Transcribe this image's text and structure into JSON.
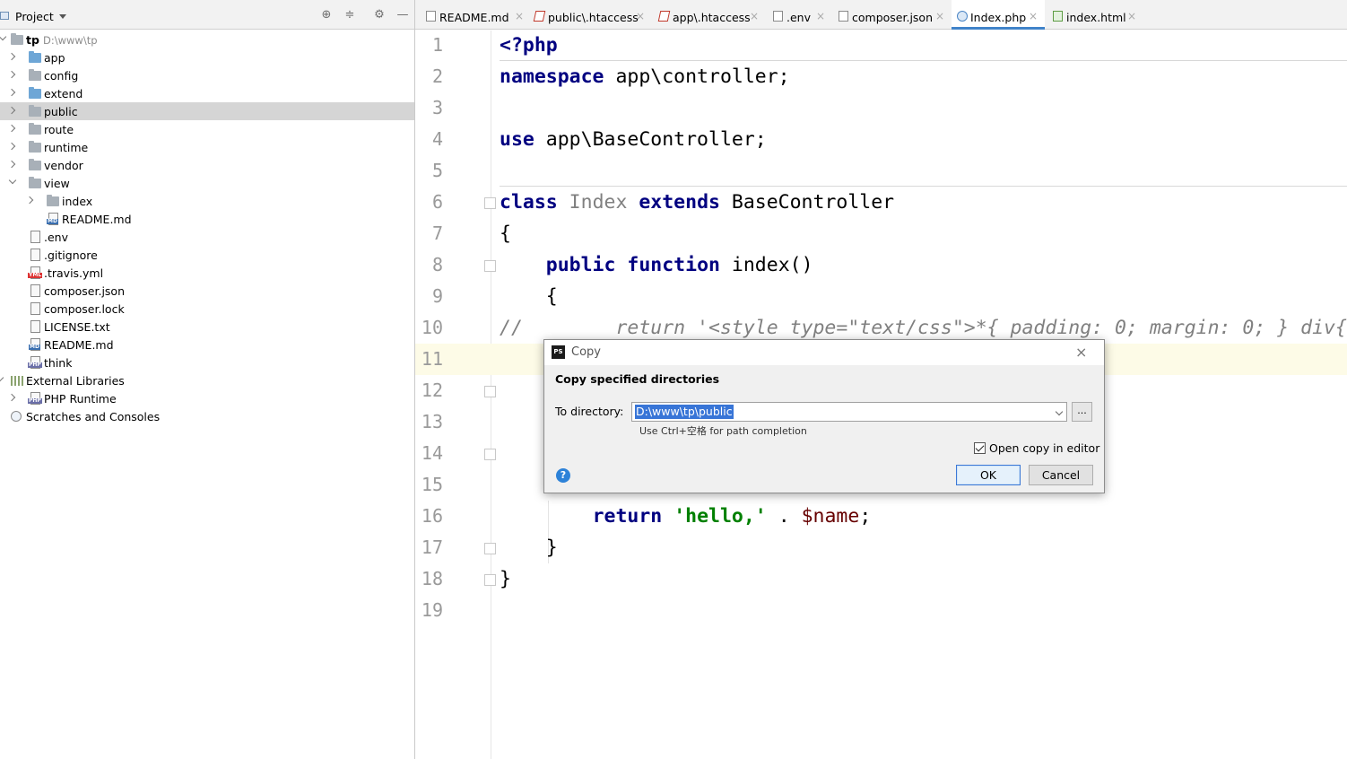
{
  "project_panel": {
    "title": "Project",
    "tree": [
      {
        "label": "tp",
        "path": "D:\\www\\tp",
        "kind": "root"
      },
      {
        "label": "app",
        "kind": "folder-blue"
      },
      {
        "label": "config",
        "kind": "folder"
      },
      {
        "label": "extend",
        "kind": "folder-blue"
      },
      {
        "label": "public",
        "kind": "folder",
        "selected": true
      },
      {
        "label": "route",
        "kind": "folder"
      },
      {
        "label": "runtime",
        "kind": "folder"
      },
      {
        "label": "vendor",
        "kind": "folder"
      },
      {
        "label": "view",
        "kind": "folder",
        "expanded": true
      },
      {
        "label": "index",
        "kind": "folder"
      },
      {
        "label": "README.md",
        "kind": "file-md"
      },
      {
        "label": ".env",
        "kind": "file"
      },
      {
        "label": ".gitignore",
        "kind": "file"
      },
      {
        "label": ".travis.yml",
        "kind": "file-yml"
      },
      {
        "label": "composer.json",
        "kind": "file"
      },
      {
        "label": "composer.lock",
        "kind": "file"
      },
      {
        "label": "LICENSE.txt",
        "kind": "file"
      },
      {
        "label": "README.md",
        "kind": "file-md"
      },
      {
        "label": "think",
        "kind": "file-php"
      },
      {
        "label": "External Libraries",
        "kind": "library"
      },
      {
        "label": "PHP Runtime",
        "kind": "file-php"
      },
      {
        "label": "Scratches and Consoles",
        "kind": "scratch"
      }
    ],
    "badges": {
      "md": "MD",
      "yml": "YML",
      "php": "PHP"
    }
  },
  "tabs": [
    {
      "label": "README.md",
      "icon": "markdown-file-icon"
    },
    {
      "label": "public\\.htaccess",
      "icon": "htaccess-file-icon"
    },
    {
      "label": "app\\.htaccess",
      "icon": "htaccess-file-icon"
    },
    {
      "label": ".env",
      "icon": "text-file-icon"
    },
    {
      "label": "composer.json",
      "icon": "composer-file-icon"
    },
    {
      "label": "Index.php",
      "icon": "php-class-icon",
      "active": true
    },
    {
      "label": "index.html",
      "icon": "html-file-icon"
    }
  ],
  "editor": {
    "line_numbers": [
      "1",
      "2",
      "3",
      "4",
      "5",
      "6",
      "7",
      "8",
      "9",
      "10",
      "11",
      "12",
      "13",
      "14",
      "15",
      "16",
      "17",
      "18",
      "19"
    ],
    "code": {
      "l1_tag": "<?php",
      "l2_kw": "namespace",
      "l2_rest": " app\\controller;",
      "l4_kw": "use",
      "l4_rest": " app\\BaseController;",
      "l6_kw1": "class",
      "l6_name": " Index ",
      "l6_kw2": "extends",
      "l6_rest": " BaseController",
      "l7": "{",
      "l8_indent": "    ",
      "l8_kw1": "public",
      "l8_kw2": "function",
      "l8_rest": " index()",
      "l9": "    {",
      "l10": "//        return '<style type=\"text/css\">*{ padding: 0; margin: 0; } div{",
      "l16_indent": "        ",
      "l16_kw": "return",
      "l16_str": "'hello,'",
      "l16_op": " . ",
      "l16_var": "$name",
      "l16_end": ";",
      "l17": "    }",
      "l18": "}"
    }
  },
  "dialog": {
    "title": "Copy",
    "app_icon": "PS",
    "heading": "Copy specified directories",
    "label": "To directory:",
    "value": "D:\\www\\tp\\public",
    "browse": "...",
    "hint": "Use Ctrl+空格 for path completion",
    "checkbox_label": "Open copy in editor",
    "checkbox_checked": true,
    "help": "?",
    "ok": "OK",
    "cancel": "Cancel",
    "close": "×"
  }
}
